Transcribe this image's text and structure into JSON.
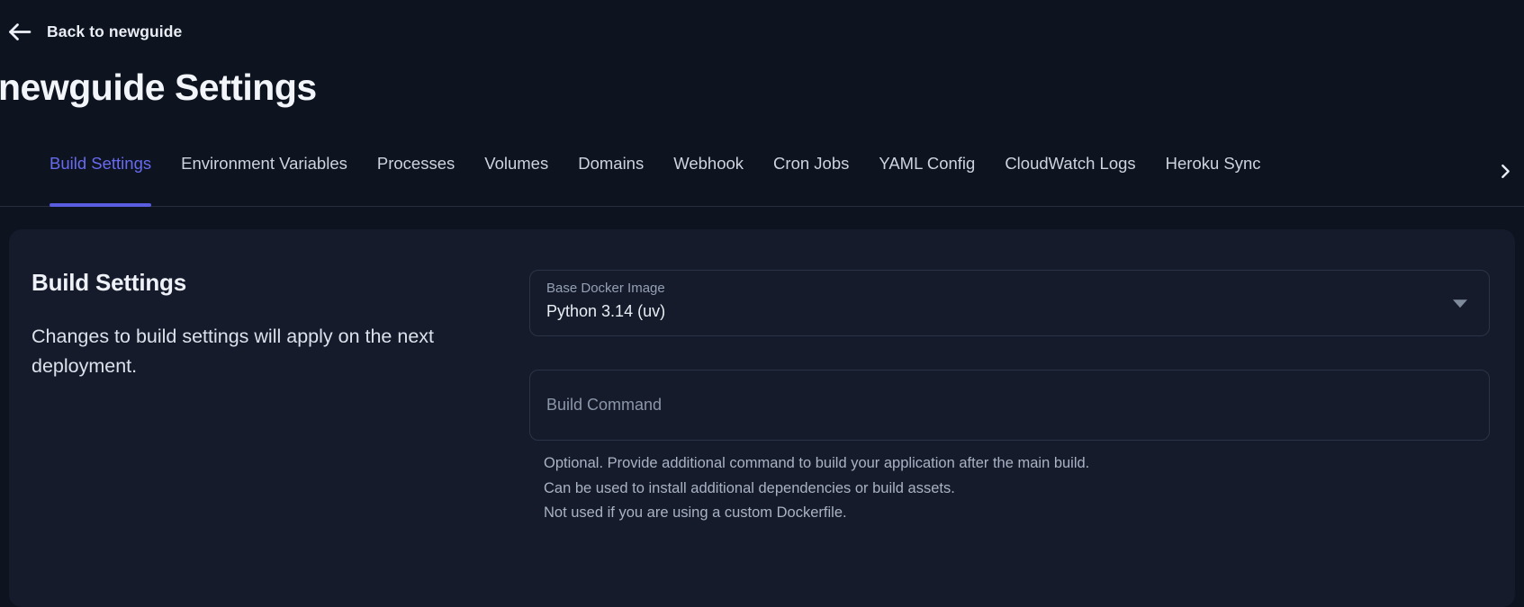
{
  "colors": {
    "page_bg": "#0d131f",
    "card_bg": "#151b2b",
    "accent": "#686af0",
    "accent_underline": "#5b5de0",
    "tab_inactive": "#ccd4df",
    "field_border": "#2b3446",
    "muted_label": "#94a0b3",
    "helper_text": "#a9b3c3"
  },
  "header": {
    "back_label": "Back to newguide",
    "title": "newguide Settings"
  },
  "tabs": {
    "items": [
      {
        "label": "Build Settings",
        "active": true
      },
      {
        "label": "Environment Variables",
        "active": false
      },
      {
        "label": "Processes",
        "active": false
      },
      {
        "label": "Volumes",
        "active": false
      },
      {
        "label": "Domains",
        "active": false
      },
      {
        "label": "Webhook",
        "active": false
      },
      {
        "label": "Cron Jobs",
        "active": false
      },
      {
        "label": "YAML Config",
        "active": false
      },
      {
        "label": "CloudWatch Logs",
        "active": false
      },
      {
        "label": "Heroku Sync",
        "active": false
      }
    ],
    "overflow_icon": "chevron-right"
  },
  "panel": {
    "heading": "Build Settings",
    "description": "Changes to build settings will apply on the next deployment.",
    "base_docker_image": {
      "label": "Base Docker Image",
      "value": "Python 3.14 (uv)",
      "icon": "dropdown-caret"
    },
    "build_command": {
      "placeholder": "Build Command",
      "value": "",
      "helper_lines": [
        "Optional. Provide additional command to build your application after the main build.",
        "Can be used to install additional dependencies or build assets.",
        "Not used if you are using a custom Dockerfile."
      ]
    }
  }
}
